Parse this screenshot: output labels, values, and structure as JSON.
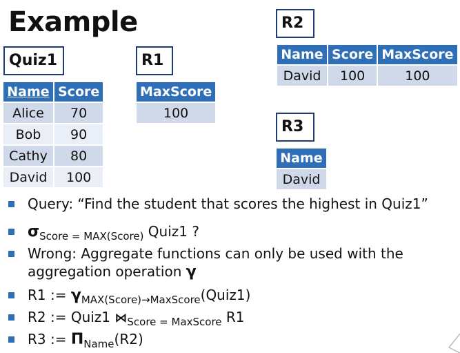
{
  "title": "Example",
  "quiz1": {
    "label": "Quiz1",
    "headers": [
      "Name",
      "Score"
    ],
    "rows": [
      [
        "Alice",
        "70"
      ],
      [
        "Bob",
        "90"
      ],
      [
        "Cathy",
        "80"
      ],
      [
        "David",
        "100"
      ]
    ]
  },
  "r1": {
    "label": "R1",
    "headers": [
      "MaxScore"
    ],
    "rows": [
      [
        "100"
      ]
    ]
  },
  "r2": {
    "label": "R2",
    "headers": [
      "Name",
      "Score",
      "MaxScore"
    ],
    "rows": [
      [
        "David",
        "100",
        "100"
      ]
    ]
  },
  "r3": {
    "label": "R3",
    "headers": [
      "Name"
    ],
    "rows": [
      [
        "David"
      ]
    ]
  },
  "bullets": {
    "query": "Query: “Find the student that scores the highest in Quiz1”",
    "sigma_symbol": "σ",
    "sigma_sub": "Score = MAX(Score)",
    "sigma_rest": " Quiz1 ?",
    "wrong_line1": "Wrong: Aggregate functions can only be used with the",
    "wrong_line2": "aggregation operation ",
    "gamma": "γ",
    "r1_prefix": "R1 := ",
    "r1_sub": "MAX(Score)→MaxScore",
    "r1_rest": "(Quiz1)",
    "r2_prefix": "R2 := Quiz1 ",
    "bowtie": "⋈",
    "r2_sub": "Score = MaxScore",
    "r2_rest": " R1",
    "r3_prefix": "R3 := ",
    "pi": "Π",
    "r3_sub": "Name",
    "r3_rest": "(R2)"
  },
  "colors": {
    "header_bg": "#2e6fb7",
    "row_alt": "#cfd9ea",
    "row_norm": "#e9eef7",
    "bullet": "#2e6fb7",
    "box_border": "#1f3b74"
  }
}
